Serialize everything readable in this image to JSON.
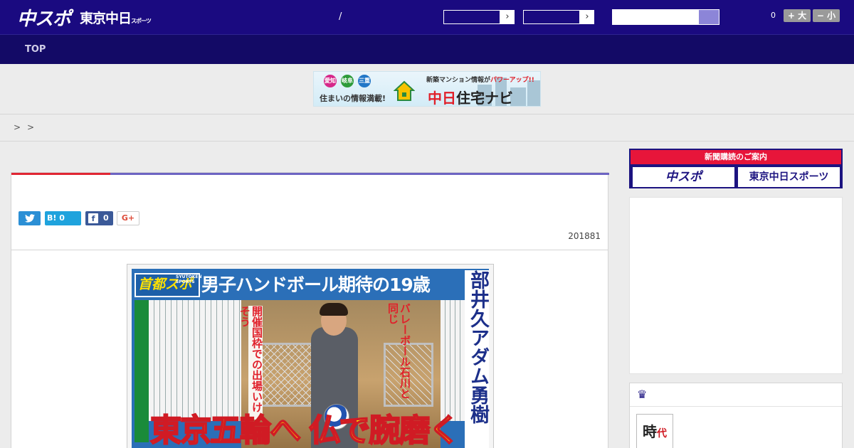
{
  "header": {
    "logo_chuspo": "中スポ",
    "logo_tokyo": "東京中日",
    "logo_tokyo_sub": "スポーツ",
    "separator": "/",
    "select1_arrow": "›",
    "select2_arrow": "›",
    "search_placeholder": "",
    "font_size_value": "0",
    "font_increase_label": "+ 大",
    "font_decrease_label": "− 小"
  },
  "nav": {
    "top_label": "TOP"
  },
  "banner": {
    "badge1": "愛知",
    "badge2": "岐阜",
    "badge3": "三重",
    "tagline": "住まいの情報満載!",
    "headline_pre": "新築マンション情報が",
    "headline_emph": "パワーアップ!!",
    "brand_red": "中日",
    "brand_rest": "住宅ナビ"
  },
  "breadcrumb": {
    "sep1": ">",
    "sep2": ">"
  },
  "article": {
    "share_twitter": "t",
    "share_hatena": "B! 0",
    "share_facebook_icon": "f",
    "share_facebook_count": "0",
    "share_gplus": "G+",
    "date": "201881"
  },
  "newspaper": {
    "logo": "首都スポ",
    "logo_sub": "SYUTOKEN SPORTS",
    "headline": "男子ハンドボール期待の19歳",
    "red_v1": "開催国枠での出場いけそう",
    "red_v2": "バレーボール石川と同じ",
    "name_v": "部井久アダム勇樹",
    "bottom": "東京五輪へ 仏で腕磨く"
  },
  "sidebar": {
    "subscribe_header": "新聞購読のご案内",
    "subscribe_chuspo": "中スポ",
    "subscribe_tokyo": "東京中日スポーツ",
    "rank_icon": "♛",
    "rank_thumb_text": "時",
    "rank_thumb_red": "代"
  },
  "colors": {
    "header_bg": "#1a0a80",
    "nav_bg": "#130a66",
    "accent_red": "#e02633",
    "accent_purple": "#6d64c3"
  }
}
